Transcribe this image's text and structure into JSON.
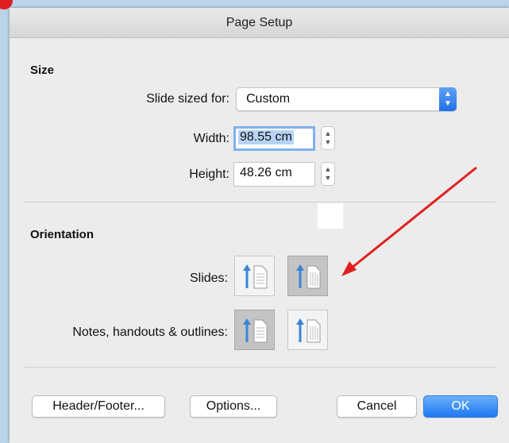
{
  "dialog": {
    "title": "Page Setup"
  },
  "size": {
    "heading": "Size",
    "slide_sized_for": {
      "label": "Slide sized for:",
      "value": "Custom"
    },
    "width": {
      "label": "Width:",
      "value": "98.55 cm"
    },
    "height": {
      "label": "Height:",
      "value": "48.26 cm"
    }
  },
  "orientation": {
    "heading": "Orientation",
    "slides": {
      "label": "Slides:",
      "selected": "landscape"
    },
    "notes": {
      "label": "Notes, handouts & outlines:",
      "selected": "portrait"
    }
  },
  "buttons": {
    "header_footer": "Header/Footer...",
    "options": "Options...",
    "cancel": "Cancel",
    "ok": "OK"
  },
  "colors": {
    "accent": "#1c78f2",
    "annotation_arrow": "#e02020",
    "orientation_arrow": "#3a86d6"
  },
  "icons": {
    "select_arrows": "chevron-up-down-icon",
    "stepper": "stepper-icon",
    "portrait": "portrait-orientation-icon",
    "landscape": "landscape-orientation-icon"
  }
}
